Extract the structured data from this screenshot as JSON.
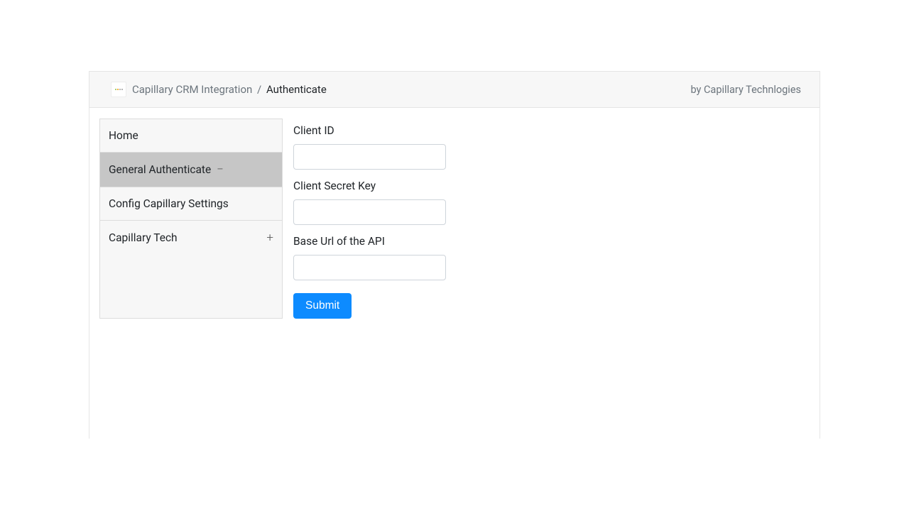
{
  "header": {
    "breadcrumb_root": "Capillary CRM Integration",
    "breadcrumb_current": "Authenticate",
    "by_text": "by Capillary Technlogies"
  },
  "sidebar": {
    "items": [
      {
        "label": "Home",
        "active": false,
        "expander": ""
      },
      {
        "label": "General Authenticate",
        "active": true,
        "expander": "−"
      },
      {
        "label": "Config Capillary Settings",
        "active": false,
        "expander": ""
      },
      {
        "label": "Capillary Tech",
        "active": false,
        "expander": "+"
      }
    ]
  },
  "form": {
    "client_id_label": "Client ID",
    "client_id_value": "",
    "client_secret_label": "Client Secret Key",
    "client_secret_value": "",
    "base_url_label": "Base Url of the API",
    "base_url_value": "",
    "submit_label": "Submit"
  }
}
